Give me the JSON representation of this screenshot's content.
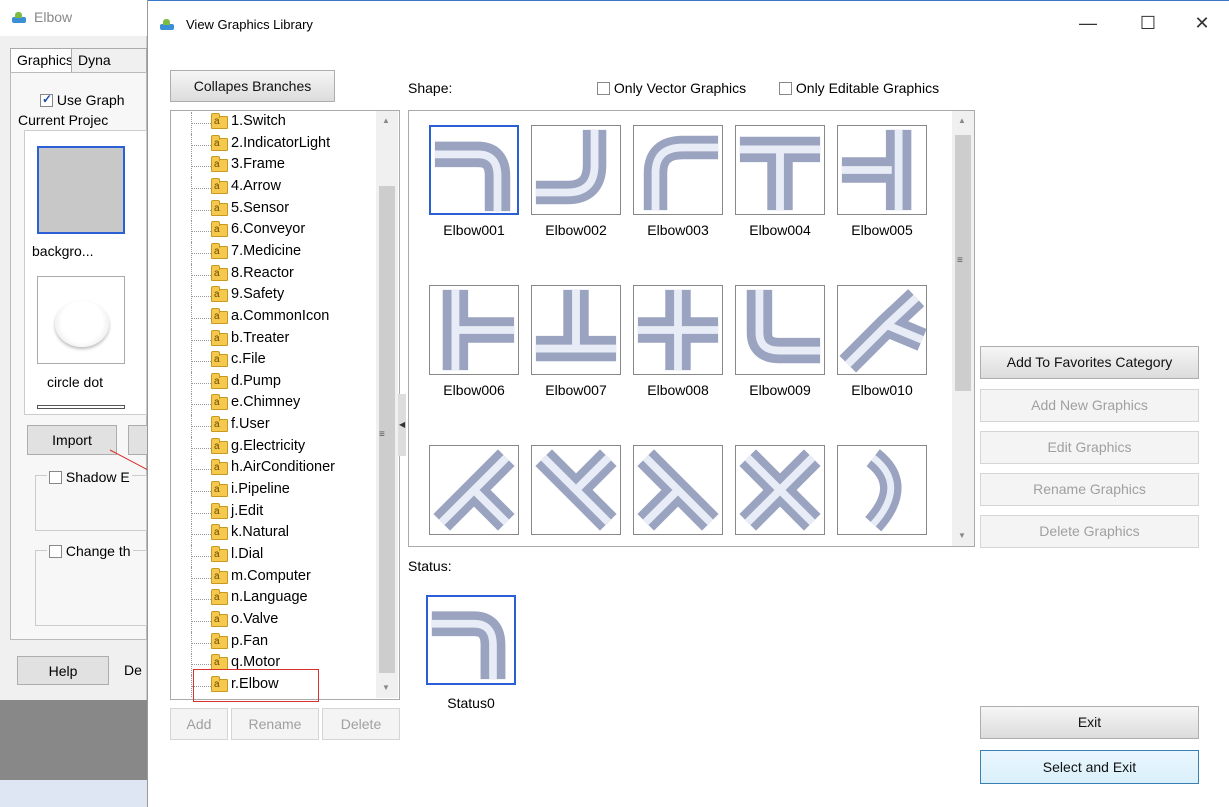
{
  "bg_window": {
    "title": "Elbow",
    "tabs": [
      "Graphics",
      "Dyna"
    ],
    "use_graph_label": "Use Graph",
    "current_project_label": "Current Projec",
    "items": [
      "backgro...",
      "circle dot"
    ],
    "import_label": "Import",
    "shadow_label": "Shadow E",
    "change_label": "Change th",
    "help_label": "Help",
    "de_label": "De"
  },
  "window": {
    "title": "View Graphics Library",
    "minimize": "—",
    "maximize": "☐",
    "close": "✕"
  },
  "collapse_button": "Collapes Branches",
  "tree": {
    "items": [
      "1.Switch",
      "2.IndicatorLight",
      "3.Frame",
      "4.Arrow",
      "5.Sensor",
      "6.Conveyor",
      "7.Medicine",
      "8.Reactor",
      "9.Safety",
      "a.CommonIcon",
      "b.Treater",
      "c.File",
      "d.Pump",
      "e.Chimney",
      "f.User",
      "g.Electricity",
      "h.AirConditioner",
      "i.Pipeline",
      "j.Edit",
      "k.Natural",
      "l.Dial",
      "m.Computer",
      "n.Language",
      "o.Valve",
      "p.Fan",
      "q.Motor",
      "r.Elbow"
    ],
    "selected": "r.Elbow"
  },
  "tree_buttons": {
    "add": "Add",
    "rename": "Rename",
    "delete": "Delete"
  },
  "shape_label": "Shape:",
  "only_vector_label": "Only Vector Graphics",
  "only_editable_label": "Only Editable Graphics",
  "shapes": [
    "Elbow001",
    "Elbow002",
    "Elbow003",
    "Elbow004",
    "Elbow005",
    "Elbow006",
    "Elbow007",
    "Elbow008",
    "Elbow009",
    "Elbow010"
  ],
  "status_label": "Status:",
  "status_items": [
    "Status0"
  ],
  "right_buttons": {
    "add_favorites": "Add To Favorites Category",
    "add_new": "Add New Graphics",
    "edit": "Edit Graphics",
    "rename": "Rename Graphics",
    "delete": "Delete Graphics",
    "exit": "Exit",
    "select_exit": "Select and Exit"
  }
}
